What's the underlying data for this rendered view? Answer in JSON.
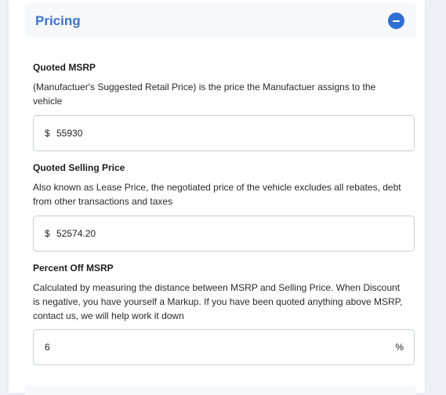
{
  "pricing": {
    "title": "Pricing",
    "collapse_icon": "minus-circle-icon",
    "accent": "#2f6fd3"
  },
  "msrp": {
    "label": "Quoted MSRP",
    "description": "(Manufactuer's Suggested Retail Price) is the price the Manufactuer assigns to the vehicle",
    "prefix": "$",
    "value": "55930"
  },
  "selling_price": {
    "label": "Quoted Selling Price",
    "description": "Also known as Lease Price, the negotiated price of the vehicle excludes all rebates, debt from other transactions and taxes",
    "prefix": "$",
    "value": "52574.20"
  },
  "percent_off": {
    "label": "Percent Off MSRP",
    "description": "Calculated by measuring the distance between MSRP and Selling Price. When Discount is negative, you have yourself a Markup. If you have been quoted anything above MSRP, contact us, we will help work it down",
    "value": "6",
    "suffix": "%"
  }
}
